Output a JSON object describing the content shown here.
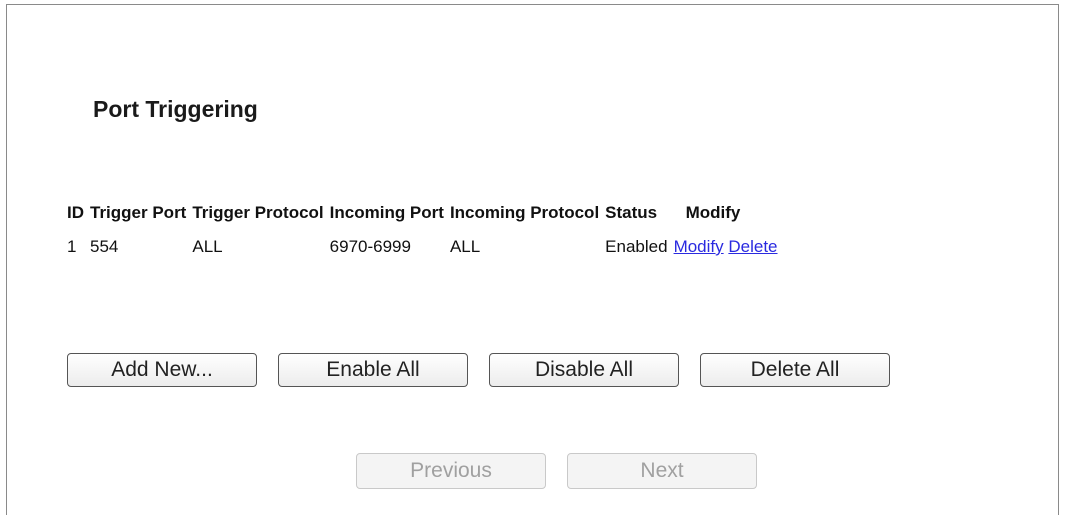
{
  "page": {
    "title": "Port Triggering"
  },
  "table": {
    "headers": {
      "id": "ID",
      "trigger_port": "Trigger Port",
      "trigger_protocol": "Trigger Protocol",
      "incoming_port": "Incoming Port",
      "incoming_protocol": "Incoming Protocol",
      "status": "Status",
      "modify": "Modify"
    },
    "rows": [
      {
        "id": "1",
        "trigger_port": "554",
        "trigger_protocol": "ALL",
        "incoming_port": "6970-6999",
        "incoming_protocol": "ALL",
        "status": "Enabled",
        "modify_link": "Modify",
        "delete_link": "Delete"
      }
    ]
  },
  "actions": {
    "add_new": "Add New...",
    "enable_all": "Enable All",
    "disable_all": "Disable All",
    "delete_all": "Delete All"
  },
  "pager": {
    "previous": "Previous",
    "next": "Next"
  },
  "colors": {
    "link": "#2a2ae0",
    "disabled_text": "#a0a0a0"
  }
}
